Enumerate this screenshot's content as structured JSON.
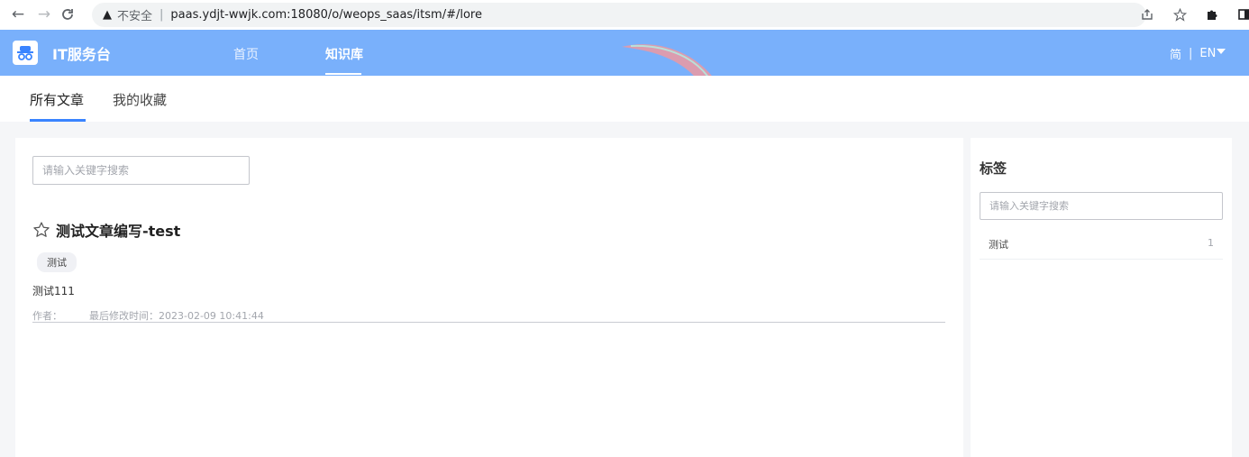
{
  "browser": {
    "back_icon": "←",
    "forward_icon": "→",
    "reload_icon": "C",
    "warning_icon": "▲",
    "insecure_label": "不安全",
    "separator": "|",
    "url": "paas.ydjt-wwjk.com:18080/o/weops_saas/itsm/#/lore"
  },
  "header": {
    "app_title": "IT服务台",
    "nav": [
      {
        "label": "首页"
      },
      {
        "label": "知识库"
      }
    ],
    "lang_zh": "简",
    "lang_sep": "|",
    "lang_en": "EN",
    "colors": {
      "header_bg": "#79b0fb",
      "accent": "#3a84ff"
    }
  },
  "tabs": [
    {
      "label": "所有文章"
    },
    {
      "label": "我的收藏"
    }
  ],
  "main": {
    "search_placeholder": "请输入关键字搜索",
    "article": {
      "title": "测试文章编写-test",
      "tag": "测试",
      "summary": "测试111",
      "author_label": "作者：",
      "modified_label": "最后修改时间：2023-02-09 10:41:44"
    }
  },
  "side": {
    "title": "标签",
    "search_placeholder": "请输入关键字搜索",
    "tags": [
      {
        "name": "测试",
        "count": "1"
      }
    ]
  }
}
